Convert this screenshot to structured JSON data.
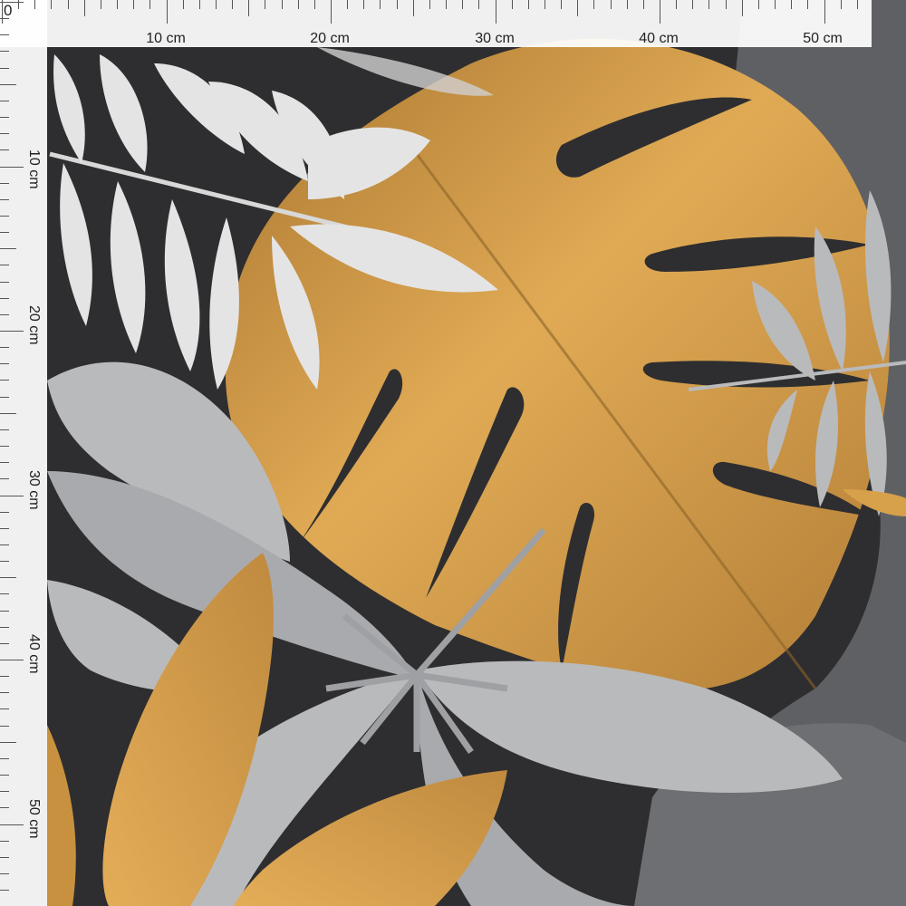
{
  "ruler": {
    "origin": "0",
    "top_labels": [
      "10 cm",
      "20 cm",
      "30 cm",
      "40 cm",
      "50 cm"
    ],
    "left_labels": [
      "10 cm",
      "20 cm",
      "30 cm",
      "40 cm",
      "50 cm"
    ]
  },
  "colors": {
    "background": "#2e2e30",
    "gold": "#d7a04a",
    "gold_dark": "#a8752f",
    "grey_light": "#b9babc",
    "grey_mid": "#6e6f72",
    "white_leaf": "#e4e4e4"
  }
}
